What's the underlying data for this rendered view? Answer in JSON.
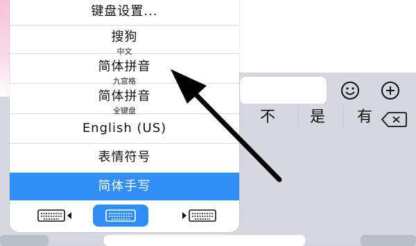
{
  "menu": {
    "items": [
      {
        "main": "键盘设置...",
        "sub": ""
      },
      {
        "main": "搜狗",
        "sub": "中文"
      },
      {
        "main": "简体拼音",
        "sub": "九宫格"
      },
      {
        "main": "简体拼音",
        "sub": "全键盘"
      },
      {
        "main": "English (US)",
        "sub": ""
      },
      {
        "main": "表情符号",
        "sub": ""
      },
      {
        "main": "简体手写",
        "sub": ""
      }
    ],
    "selected_index": 6,
    "switcher": [
      "keyboard-left-icon",
      "keyboard-center-icon",
      "keyboard-right-icon"
    ],
    "switcher_active": 1
  },
  "candidates": [
    "不",
    "是",
    "有"
  ],
  "icons": {
    "emoji": "smiley-icon",
    "add": "plus-circle-icon",
    "backspace": "backspace-icon"
  },
  "colors": {
    "accent": "#2f8ff5",
    "keyboard_bg": "#d5d8de"
  }
}
